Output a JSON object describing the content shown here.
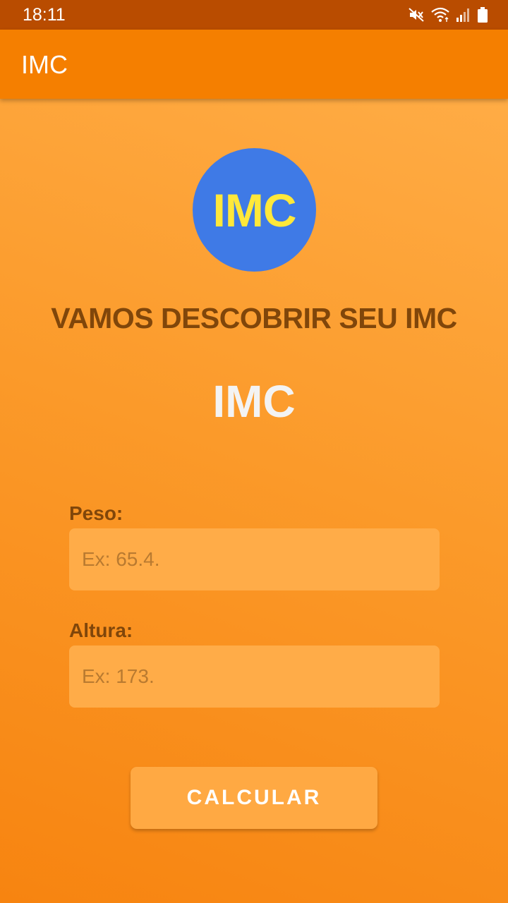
{
  "status_bar": {
    "time": "18:11",
    "icons": [
      "mute-icon",
      "wifi-icon",
      "signal-icon",
      "battery-icon"
    ]
  },
  "app_bar": {
    "title": "IMC"
  },
  "logo": {
    "text": "IMC"
  },
  "headline": "VAMOS DESCOBRIR SEU IMC",
  "result": "IMC",
  "form": {
    "peso_label": "Peso:",
    "peso_placeholder": "Ex: 65.4.",
    "peso_value": "",
    "altura_label": "Altura:",
    "altura_placeholder": "Ex: 173.",
    "altura_value": ""
  },
  "button": {
    "calculate_label": "CALCULAR"
  },
  "colors": {
    "status_bar": "#b94c00",
    "app_bar": "#f57f00",
    "logo_circle": "#3f7ae6",
    "logo_text": "#ffe83a",
    "label_text": "#80460a",
    "input_bg": "#ffac48"
  }
}
